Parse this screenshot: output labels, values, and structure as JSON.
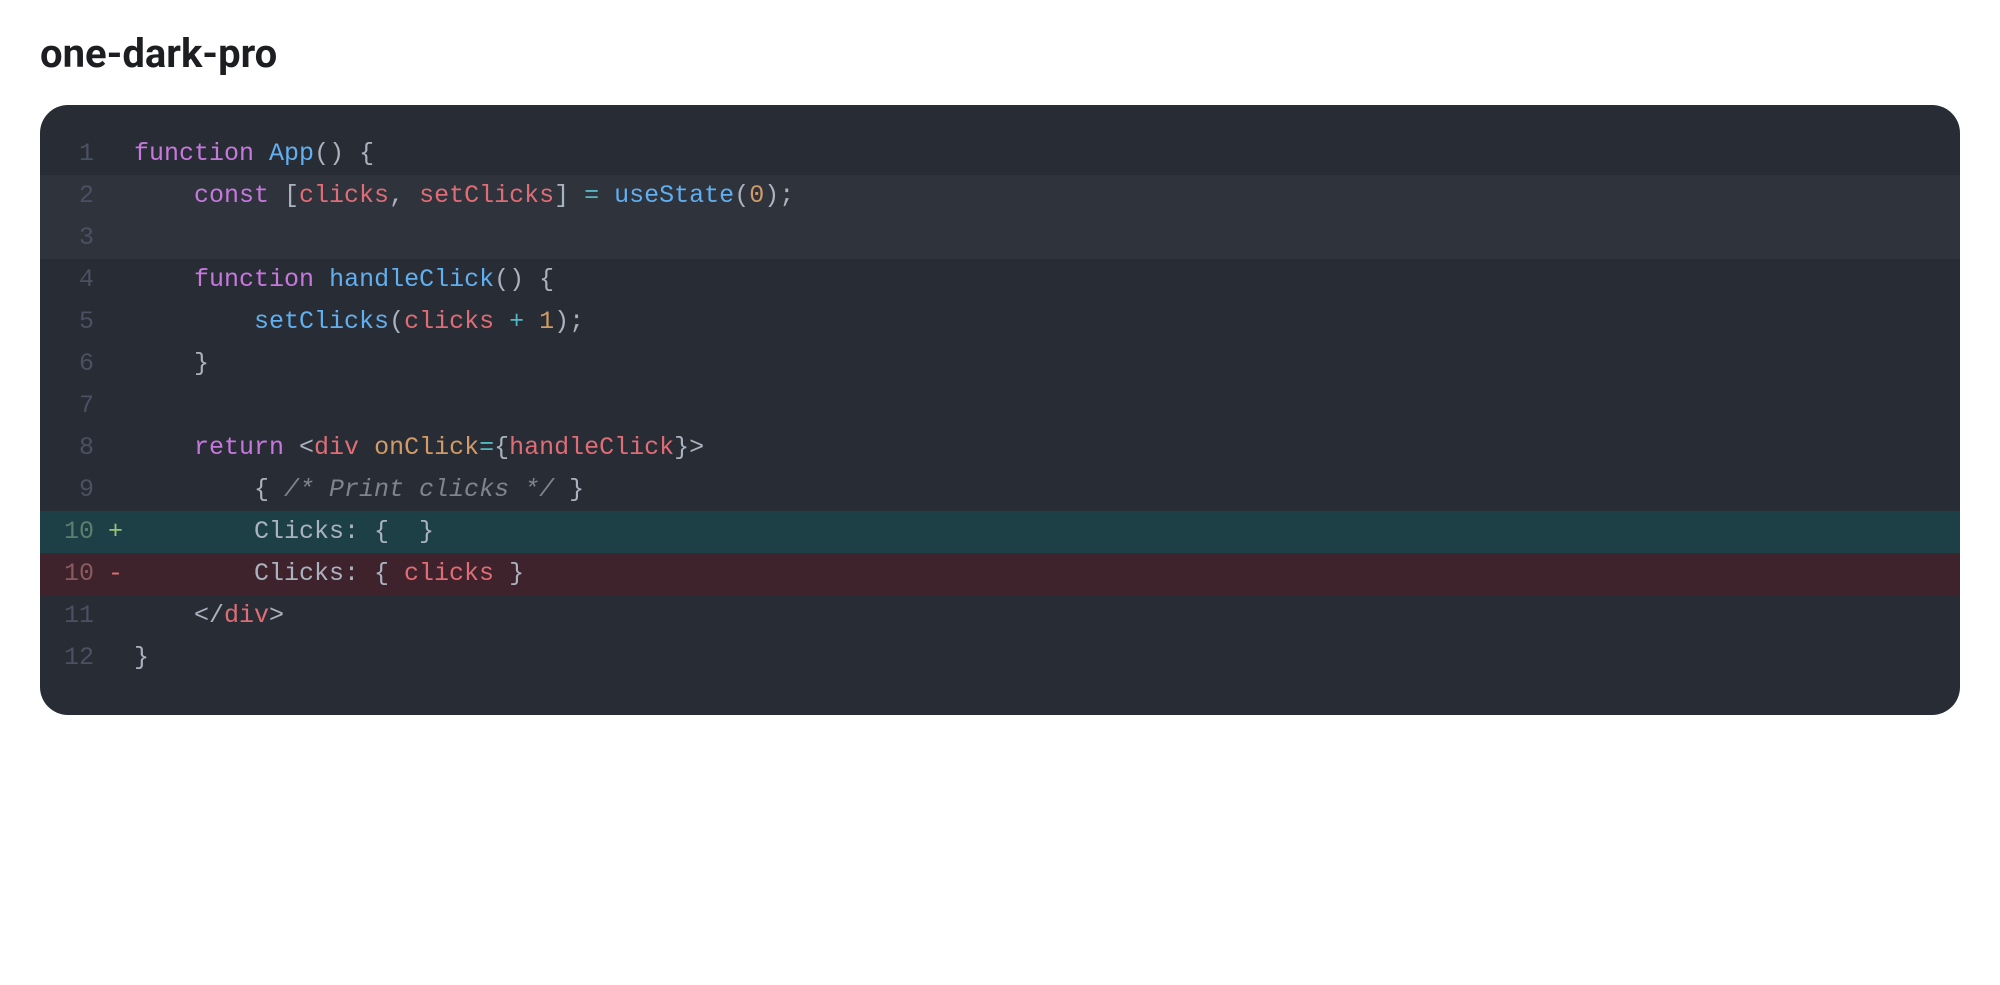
{
  "title": "one-dark-pro",
  "colors": {
    "background": "#282c34",
    "gutter": "#495162",
    "default": "#abb2bf",
    "keyword": "#c678dd",
    "function": "#61afef",
    "variable": "#e06c75",
    "attribute": "#d19a66",
    "string": "#98c379",
    "comment": "#7f848e",
    "operator": "#56b6c2",
    "diff_add_bg": "rgba(22,78,85,0.6)",
    "diff_del_bg": "rgba(78,30,40,0.6)"
  },
  "lines": [
    {
      "num": "1",
      "diff": "",
      "highlight": false,
      "tokens": [
        {
          "cls": "tok-kw",
          "text": "function"
        },
        {
          "cls": "tok-pn",
          "text": " "
        },
        {
          "cls": "tok-fn",
          "text": "App"
        },
        {
          "cls": "tok-pn",
          "text": "() {"
        }
      ]
    },
    {
      "num": "2",
      "diff": "",
      "highlight": true,
      "tokens": [
        {
          "cls": "tok-pn",
          "text": "    "
        },
        {
          "cls": "tok-kw",
          "text": "const"
        },
        {
          "cls": "tok-pn",
          "text": " ["
        },
        {
          "cls": "tok-var",
          "text": "clicks"
        },
        {
          "cls": "tok-pn",
          "text": ", "
        },
        {
          "cls": "tok-var",
          "text": "setClicks"
        },
        {
          "cls": "tok-pn",
          "text": "] "
        },
        {
          "cls": "tok-op",
          "text": "="
        },
        {
          "cls": "tok-pn",
          "text": " "
        },
        {
          "cls": "tok-fn",
          "text": "useState"
        },
        {
          "cls": "tok-pn",
          "text": "("
        },
        {
          "cls": "tok-attr",
          "text": "0"
        },
        {
          "cls": "tok-pn",
          "text": ");"
        }
      ]
    },
    {
      "num": "3",
      "diff": "",
      "highlight": true,
      "tokens": [
        {
          "cls": "tok-pn",
          "text": ""
        }
      ]
    },
    {
      "num": "4",
      "diff": "",
      "highlight": false,
      "tokens": [
        {
          "cls": "tok-pn",
          "text": "    "
        },
        {
          "cls": "tok-kw",
          "text": "function"
        },
        {
          "cls": "tok-pn",
          "text": " "
        },
        {
          "cls": "tok-fn",
          "text": "handleClick"
        },
        {
          "cls": "tok-pn",
          "text": "() {"
        }
      ]
    },
    {
      "num": "5",
      "diff": "",
      "highlight": false,
      "tokens": [
        {
          "cls": "tok-pn",
          "text": "        "
        },
        {
          "cls": "tok-fn",
          "text": "setClicks"
        },
        {
          "cls": "tok-pn",
          "text": "("
        },
        {
          "cls": "tok-var",
          "text": "clicks"
        },
        {
          "cls": "tok-pn",
          "text": " "
        },
        {
          "cls": "tok-op",
          "text": "+"
        },
        {
          "cls": "tok-pn",
          "text": " "
        },
        {
          "cls": "tok-attr",
          "text": "1"
        },
        {
          "cls": "tok-pn",
          "text": ");"
        }
      ]
    },
    {
      "num": "6",
      "diff": "",
      "highlight": false,
      "tokens": [
        {
          "cls": "tok-pn",
          "text": "    }"
        }
      ]
    },
    {
      "num": "7",
      "diff": "",
      "highlight": false,
      "tokens": [
        {
          "cls": "tok-pn",
          "text": ""
        }
      ]
    },
    {
      "num": "8",
      "diff": "",
      "highlight": false,
      "tokens": [
        {
          "cls": "tok-pn",
          "text": "    "
        },
        {
          "cls": "tok-kw",
          "text": "return"
        },
        {
          "cls": "tok-pn",
          "text": " <"
        },
        {
          "cls": "tok-tag",
          "text": "div"
        },
        {
          "cls": "tok-pn",
          "text": " "
        },
        {
          "cls": "tok-attr",
          "text": "onClick"
        },
        {
          "cls": "tok-op",
          "text": "="
        },
        {
          "cls": "tok-pn",
          "text": "{"
        },
        {
          "cls": "tok-var",
          "text": "handleClick"
        },
        {
          "cls": "tok-pn",
          "text": "}>"
        }
      ]
    },
    {
      "num": "9",
      "diff": "",
      "highlight": false,
      "tokens": [
        {
          "cls": "tok-pn",
          "text": "        { "
        },
        {
          "cls": "tok-cmt",
          "text": "/* Print clicks */"
        },
        {
          "cls": "tok-pn",
          "text": " }"
        }
      ]
    },
    {
      "num": "10",
      "diff": "+",
      "highlight": false,
      "tokens": [
        {
          "cls": "tok-pn",
          "text": "        Clicks: {  }"
        }
      ]
    },
    {
      "num": "10",
      "diff": "-",
      "highlight": false,
      "tokens": [
        {
          "cls": "tok-pn",
          "text": "        Clicks: { "
        },
        {
          "cls": "tok-var",
          "text": "clicks"
        },
        {
          "cls": "tok-pn",
          "text": " }"
        }
      ]
    },
    {
      "num": "11",
      "diff": "",
      "highlight": false,
      "tokens": [
        {
          "cls": "tok-pn",
          "text": "    </"
        },
        {
          "cls": "tok-tag",
          "text": "div"
        },
        {
          "cls": "tok-pn",
          "text": ">"
        }
      ]
    },
    {
      "num": "12",
      "diff": "",
      "highlight": false,
      "tokens": [
        {
          "cls": "tok-pn",
          "text": "}"
        }
      ]
    }
  ]
}
